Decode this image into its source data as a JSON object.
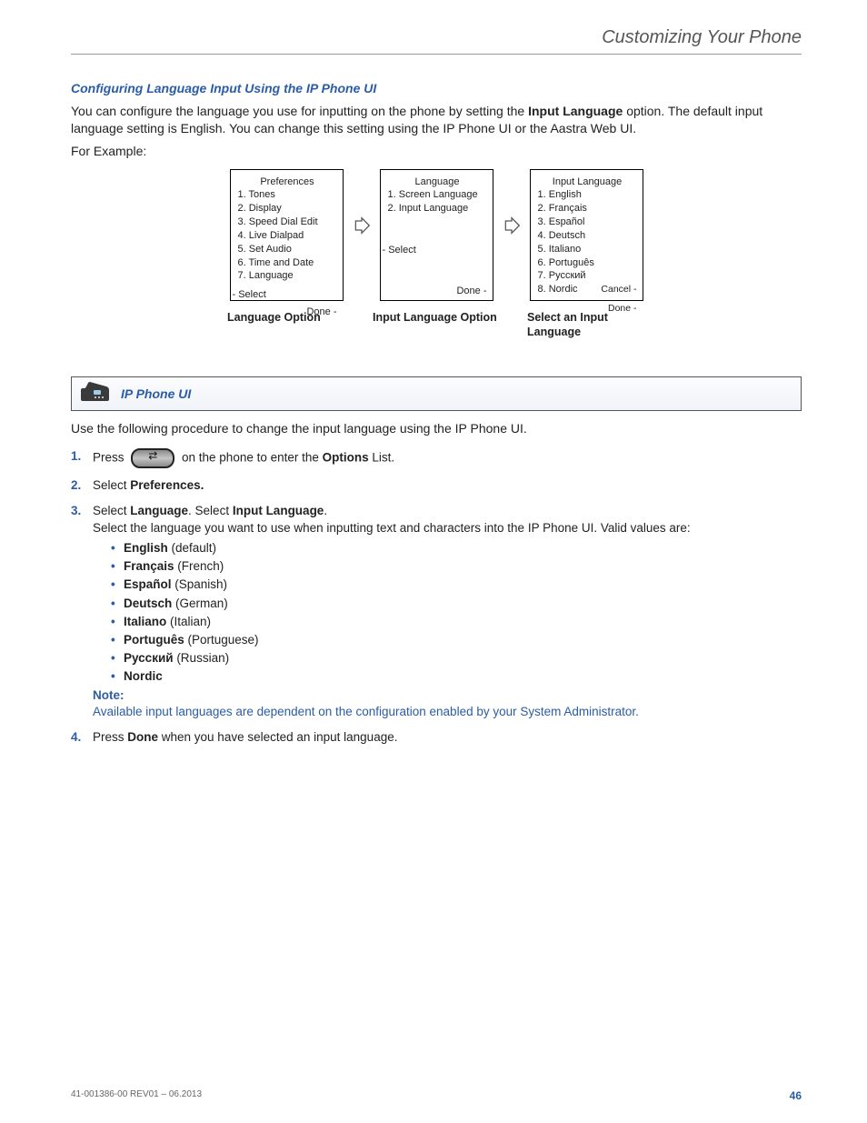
{
  "header": {
    "breadcrumb": "Customizing Your Phone"
  },
  "section": {
    "title": "Configuring Language Input Using the IP Phone UI",
    "para1a": "You can configure the language you use for inputting on the phone by setting the ",
    "para1b": "Input Language",
    "para1c": " option. The default input language setting is English. You can change this setting using the IP Phone UI or the Aastra Web UI.",
    "para2": "For Example:"
  },
  "screens": {
    "s1": {
      "title": "Preferences",
      "items": [
        "1. Tones",
        "2. Display",
        "3. Speed Dial Edit",
        "4. Live Dialpad",
        "5. Set Audio",
        "6. Time and Date",
        "7. Language"
      ],
      "mid": "- Select",
      "bot": "Done -",
      "caption": "Language Option"
    },
    "s2": {
      "title": "Language",
      "items": [
        "1. Screen Language",
        "2. Input Language"
      ],
      "mid": "- Select",
      "bot": "Done -",
      "caption": "Input Language Option"
    },
    "s3": {
      "title": "Input Language",
      "items": [
        "1. English",
        "2. Français",
        "3. Español",
        "4. Deutsch",
        "5. Italiano",
        "6. Português",
        "7. Русский",
        "8. Nordic"
      ],
      "botL": "Cancel -",
      "botR": "Done -",
      "caption": "Select an Input Language"
    }
  },
  "panel": {
    "title": "IP Phone UI"
  },
  "intro": "Use the following procedure to change the input language using the IP Phone UI.",
  "steps": {
    "s1a": "Press ",
    "s1b": " on the phone to enter the ",
    "s1c": "Options",
    "s1d": " List.",
    "s2a": "Select ",
    "s2b": "Preferences.",
    "s3a": "Select ",
    "s3b": "Language",
    "s3c": ". Select ",
    "s3d": "Input Language",
    "s3e": ".",
    "s3desc": "Select the language you want to use when inputting text and characters into the IP Phone UI. Valid values are:",
    "langs": [
      {
        "b": "English",
        "p": " (default)"
      },
      {
        "b": "Français",
        "p": " (French)"
      },
      {
        "b": "Español",
        "p": " (Spanish)"
      },
      {
        "b": "Deutsch",
        "p": " (German)"
      },
      {
        "b": "Italiano",
        "p": " (Italian)"
      },
      {
        "b": "Português",
        "p": " (Portuguese)"
      },
      {
        "b": "Русский",
        "p": " (Russian)"
      },
      {
        "b": "Nordic",
        "p": ""
      }
    ],
    "noteLabel": "Note:",
    "noteText": "Available input languages are dependent on the configuration enabled by your System Administrator.",
    "s4a": "Press ",
    "s4b": "Done",
    "s4c": " when you have selected an input language."
  },
  "footer": {
    "left": "41-001386-00 REV01 – 06.2013",
    "page": "46"
  }
}
